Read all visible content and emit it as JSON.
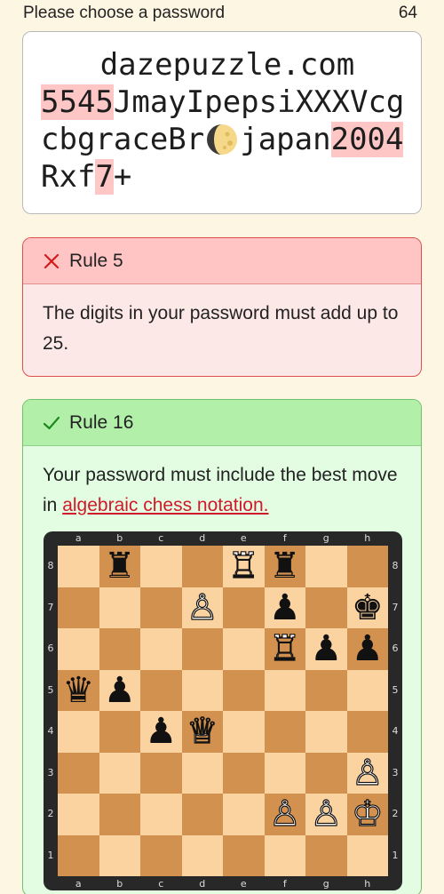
{
  "header": {
    "title": "Please choose a password",
    "char_count": "64"
  },
  "password": {
    "segments": [
      {
        "text": "dazepuzzle.com",
        "highlight": false,
        "center": true
      },
      {
        "text": "5545",
        "highlight": true
      },
      {
        "text": "JmayIpepsiXXXVcgcbgraceBr",
        "highlight": false
      },
      {
        "moon": true
      },
      {
        "text": "japan",
        "highlight": false
      },
      {
        "text": "2004",
        "highlight": true
      },
      {
        "text": "Rxf",
        "highlight": false
      },
      {
        "text": "7",
        "highlight": true
      },
      {
        "text": "+",
        "highlight": false
      }
    ]
  },
  "rule_failed": {
    "title": "Rule 5",
    "status": "failed",
    "text": "The digits in your password must add up to 25.",
    "color": "#ffc4c4"
  },
  "rule_passed": {
    "title": "Rule 16",
    "status": "passed",
    "text_before": "Your password must include the best move in ",
    "link_text": "algebraic chess notation.",
    "color": "#b2f0aa"
  },
  "chess": {
    "files": [
      "a",
      "b",
      "c",
      "d",
      "e",
      "f",
      "g",
      "h"
    ],
    "ranks": [
      "8",
      "7",
      "6",
      "5",
      "4",
      "3",
      "2",
      "1"
    ],
    "pieces": [
      {
        "square": "b8",
        "piece": "rook",
        "color": "black"
      },
      {
        "square": "e8",
        "piece": "rook",
        "color": "white"
      },
      {
        "square": "f8",
        "piece": "rook",
        "color": "black"
      },
      {
        "square": "d7",
        "piece": "pawn",
        "color": "white"
      },
      {
        "square": "f7",
        "piece": "pawn",
        "color": "black"
      },
      {
        "square": "h7",
        "piece": "king",
        "color": "black"
      },
      {
        "square": "f6",
        "piece": "rook",
        "color": "white"
      },
      {
        "square": "g6",
        "piece": "pawn",
        "color": "black"
      },
      {
        "square": "h6",
        "piece": "pawn",
        "color": "black"
      },
      {
        "square": "a5",
        "piece": "queen",
        "color": "black"
      },
      {
        "square": "b5",
        "piece": "pawn",
        "color": "black"
      },
      {
        "square": "c4",
        "piece": "pawn",
        "color": "black"
      },
      {
        "square": "d4",
        "piece": "queen",
        "color": "white"
      },
      {
        "square": "h3",
        "piece": "pawn",
        "color": "white"
      },
      {
        "square": "f2",
        "piece": "pawn",
        "color": "white"
      },
      {
        "square": "g2",
        "piece": "pawn",
        "color": "white"
      },
      {
        "square": "h2",
        "piece": "king",
        "color": "white"
      }
    ],
    "light_color": "#fbd3a0",
    "dark_color": "#d3914f"
  }
}
